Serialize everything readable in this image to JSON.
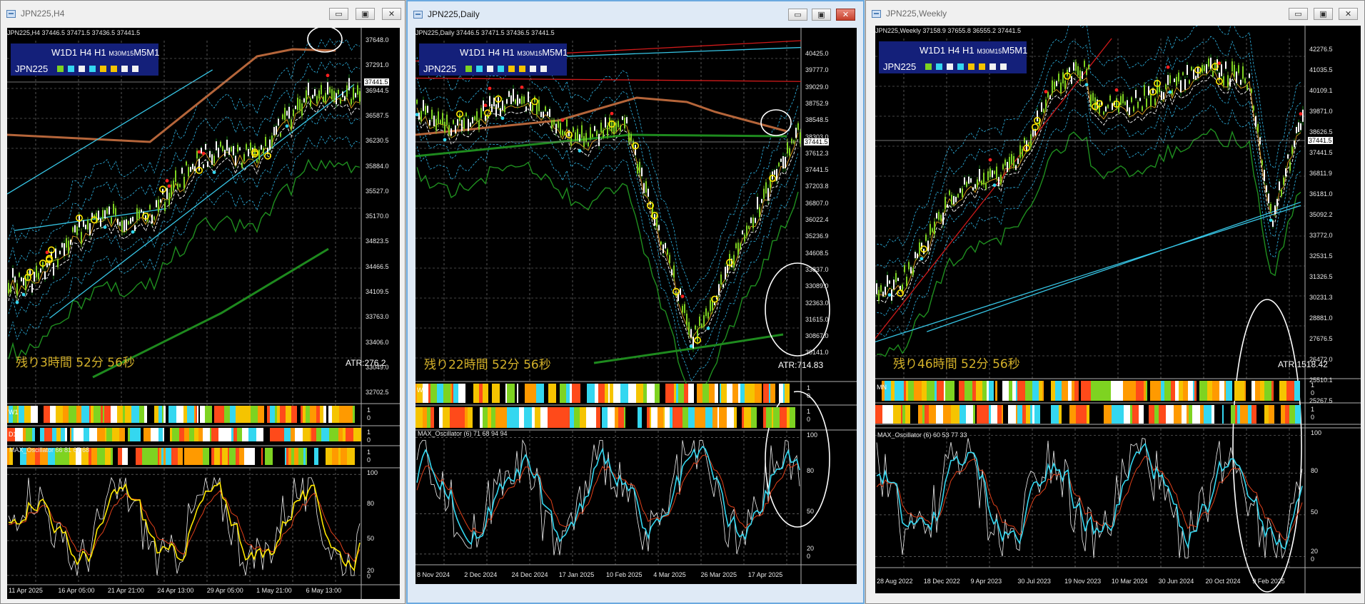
{
  "windows": [
    {
      "title": "JPN225,H4",
      "info": "JPN225,H4  37446.5 37471.5 37436.5 37441.5",
      "panel": {
        "tf_a": "W1D1 H4 H1 ",
        "tf_b": "M30M15",
        "tf_c": "M5M1",
        "symbol": "JPN225",
        "dot_colors": [
          "#7ed321",
          "#34d7f0",
          "#f2f2f2",
          "#34d7f0",
          "#f5c400",
          "#f5c400",
          "#f2f2f2",
          "#f2f2f2"
        ]
      },
      "countdown": "残り3時間 52分 56秒",
      "atr": "ATR:276.2",
      "osc_label": "MAX_Oscillator 66 81 67 68",
      "price_labels": [
        "37648.0",
        "37291.0",
        "36944.5",
        "36587.5",
        "36230.5",
        "35884.0",
        "35527.0",
        "35170.0",
        "34823.5",
        "34466.5",
        "34109.5",
        "33763.0",
        "33406.0",
        "33049.0",
        "32702.5"
      ],
      "current_price": "37441.5",
      "osc_levels": [
        "100",
        "80",
        "50",
        "20",
        "0"
      ],
      "bar_values": [
        "1",
        "0",
        "1",
        "0",
        "1",
        "0"
      ],
      "time_labels": [
        "11 Apr 2025",
        "16 Apr 05:00",
        "21 Apr 21:00",
        "24 Apr 13:00",
        "29 Apr 05:00",
        "1 May 21:00",
        "6 May 13:00"
      ],
      "row_labels": [
        "W1",
        "D1"
      ]
    },
    {
      "title": "JPN225,Daily",
      "info": "JPN225,Daily  37446.5 37471.5 37436.5 37441.5",
      "panel": {
        "tf_a": "W1D1 H4 H1 ",
        "tf_b": "M30M15",
        "tf_c": "M5M1",
        "symbol": "JPN225",
        "dot_colors": [
          "#7ed321",
          "#34d7f0",
          "#f2f2f2",
          "#34d7f0",
          "#f5c400",
          "#f5c400",
          "#f2f2f2",
          "#f2f2f2"
        ]
      },
      "countdown": "残り22時間 52分 56秒",
      "atr": "ATR:714.83",
      "osc_label": "MAX_Oscillator (6) 71 68 94 94",
      "price_labels": [
        "40425.0",
        "39777.0",
        "39029.0",
        "38752.9",
        "38548.5",
        "38303.0",
        "37612.3",
        "37441.5",
        "37203.8",
        "36807.0",
        "36022.4",
        "35236.9",
        "34608.5",
        "33837.0",
        "33089.0",
        "32363.0",
        "31615.0",
        "30867.0",
        "30141.0"
      ],
      "current_price": "37441.5",
      "osc_levels": [
        "100",
        "80",
        "50",
        "20",
        "0"
      ],
      "bar_values": [
        "1",
        "0",
        "1",
        "0"
      ],
      "time_labels": [
        "8 Nov 2024",
        "2 Dec 2024",
        "24 Dec 2024",
        "17 Jan 2025",
        "10 Feb 2025",
        "4 Mar 2025",
        "26 Mar 2025",
        "17 Apr 2025"
      ],
      "row_labels": [
        "W1"
      ]
    },
    {
      "title": "JPN225,Weekly",
      "info": "JPN225,Weekly  37158.9 37655.8 36555.2 37441.5",
      "panel": {
        "tf_a": "W1D1 H4 H1 ",
        "tf_b": "M30M15",
        "tf_c": "M5M1",
        "symbol": "JPN225",
        "dot_colors": [
          "#7ed321",
          "#34d7f0",
          "#f2f2f2",
          "#34d7f0",
          "#f5c400",
          "#f5c400",
          "#f2f2f2",
          "#f2f2f2"
        ]
      },
      "countdown": "残り46時間 52分 56秒",
      "atr": "ATR:1518.42",
      "osc_label": "MAX_Oscillator (6) 60 53 77 33",
      "price_labels": [
        "42276.5",
        "41035.5",
        "40109.1",
        "39871.0",
        "38626.5",
        "37441.5",
        "36811.9",
        "36181.0",
        "35092.2",
        "33772.0",
        "32531.5",
        "31326.5",
        "30231.3",
        "28881.0",
        "27676.5",
        "26472.0",
        "25510.1",
        "25267.5"
      ],
      "current_price": "37441.5",
      "osc_levels": [
        "100",
        "80",
        "50",
        "20",
        "0"
      ],
      "bar_values": [
        "1",
        "0",
        "1",
        "0"
      ],
      "time_labels": [
        "28 Aug 2022",
        "18 Dec 2022",
        "9 Apr 2023",
        "30 Jul 2023",
        "19 Nov 2023",
        "10 Mar 2024",
        "30 Jun 2024",
        "20 Oct 2024",
        "9 Feb 2025"
      ],
      "row_labels": [
        "MN"
      ]
    }
  ],
  "colors": {
    "bull": "#7ed321",
    "bear": "#1a9a1a",
    "ma_brown": "#b5653a",
    "trend_cyan": "#37c6e6",
    "trend_red": "#d11a1a",
    "ma_green": "#1f8f1f",
    "osc_white": "#f0f0f0",
    "osc_cyan": "#34d7f0",
    "osc_red": "#e0401a",
    "osc_yellow": "#ffe800",
    "countdown": "#d4b12a",
    "panel_bg": "#14207a"
  },
  "buttons": {
    "minimize": "▭",
    "maximize": "▣",
    "close": "✕"
  }
}
